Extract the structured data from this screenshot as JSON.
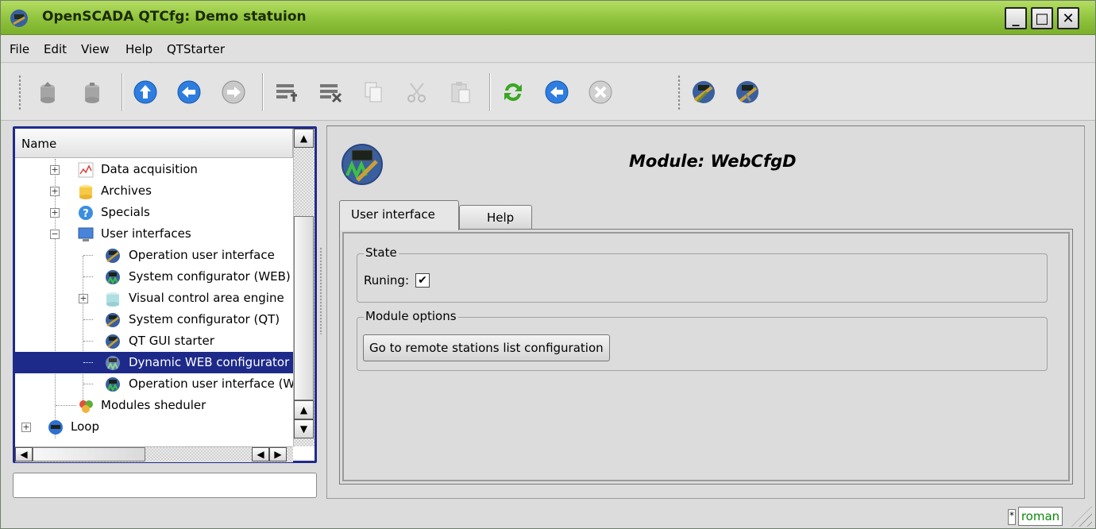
{
  "window": {
    "title": "OpenSCADA QTCfg: Demo statuion",
    "minimize": "_",
    "maximize": "□",
    "close": "✕"
  },
  "menu": [
    "File",
    "Edit",
    "View",
    "Help",
    "QTStarter"
  ],
  "toolbar": {
    "icons": [
      "db-load-icon",
      "db-save-icon",
      "up-icon",
      "back-icon",
      "forward-icon",
      "item-add-icon",
      "item-delete-icon",
      "copy-icon",
      "cut-icon",
      "paste-icon",
      "refresh-icon",
      "start-icon",
      "stop-icon",
      "qtcfg-icon",
      "qtstarter-icon"
    ]
  },
  "tree": {
    "header": "Name",
    "items": [
      {
        "label": "Data acquisition",
        "icon": "data-acquisition-icon"
      },
      {
        "label": "Archives",
        "icon": "archives-icon"
      },
      {
        "label": "Specials",
        "icon": "specials-icon"
      },
      {
        "label": "User interfaces",
        "icon": "user-interfaces-icon"
      },
      {
        "label": "Operation user interface",
        "icon": "module-icon"
      },
      {
        "label": "System configurator (WEB)",
        "icon": "module-icon"
      },
      {
        "label": "Visual control area engine",
        "icon": "module-icon"
      },
      {
        "label": "System configurator (QT)",
        "icon": "module-icon"
      },
      {
        "label": "QT GUI starter",
        "icon": "module-icon"
      },
      {
        "label": "Dynamic WEB configurator",
        "icon": "module-icon"
      },
      {
        "label": "Operation user interface (WEB)",
        "icon": "module-icon"
      },
      {
        "label": "Modules sheduler",
        "icon": "modules-sheduler-icon"
      },
      {
        "label": "Loop",
        "icon": "station-icon"
      }
    ]
  },
  "module": {
    "title": "Module: WebCfgD",
    "tabs": [
      "User interface",
      "Help"
    ],
    "state_group": "State",
    "running_label": "Runing:",
    "running_checked": true,
    "running_mark": "✔",
    "options_group": "Module options",
    "remote_button": "Go to remote stations list configuration"
  },
  "statusbar": {
    "star": "*",
    "user": "roman"
  },
  "colors": {
    "titlebar": "#8fc33c",
    "selection": "#1e2a89",
    "user_text": "#0b8a0b"
  }
}
